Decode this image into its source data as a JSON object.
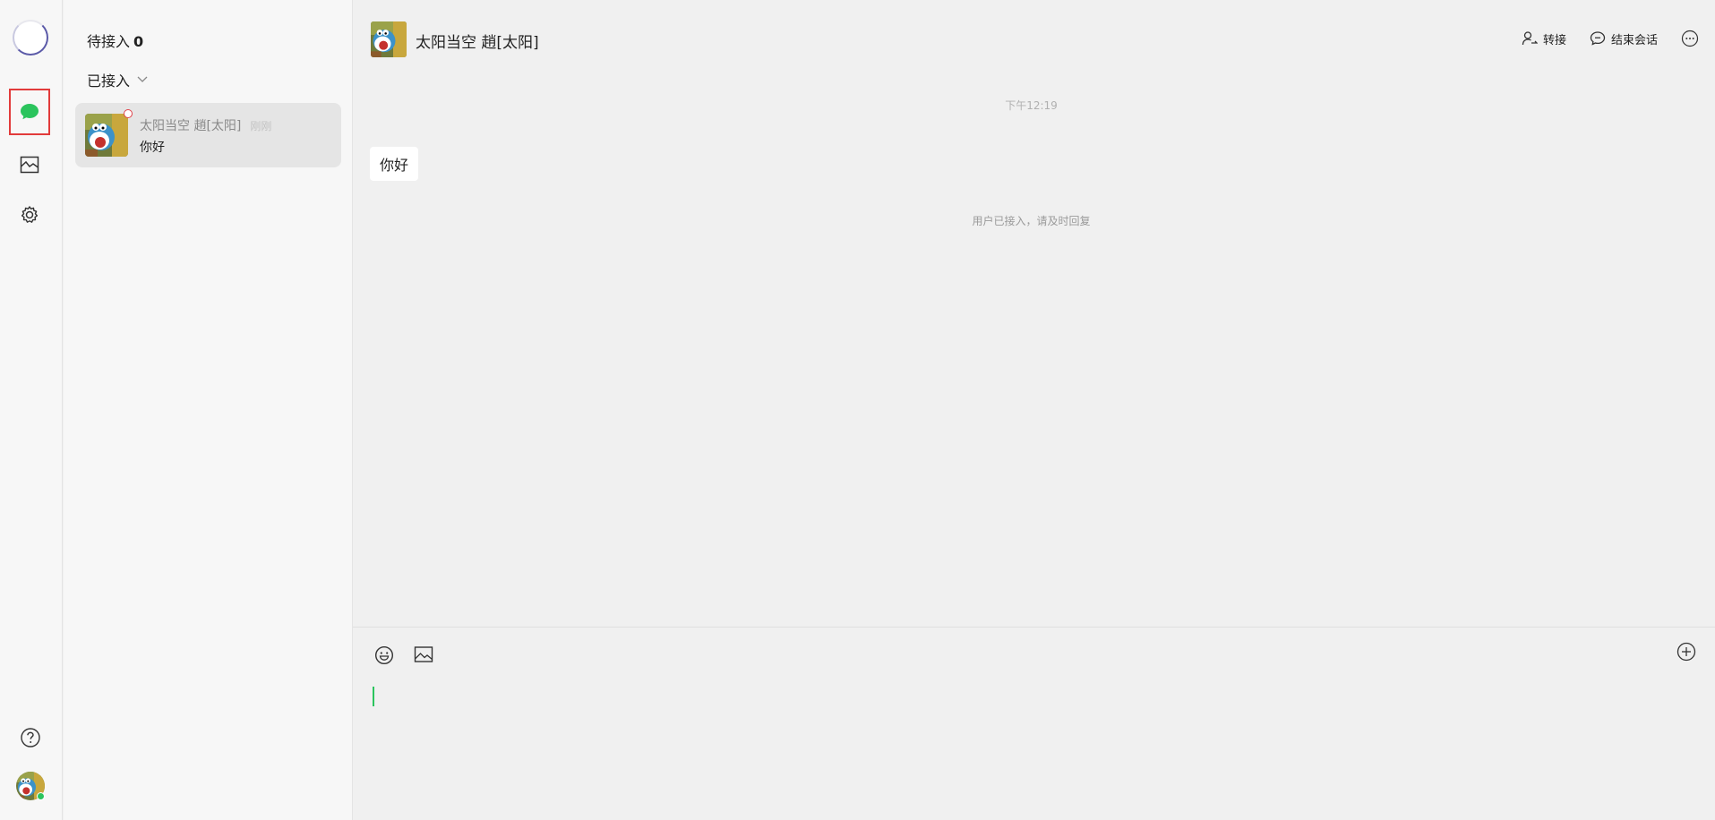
{
  "rail": {
    "items": [
      {
        "name": "chat",
        "icon": "chat-bubble-icon",
        "active": true
      },
      {
        "name": "stats",
        "icon": "chart-icon",
        "active": false
      },
      {
        "name": "settings",
        "icon": "gear-icon",
        "active": false
      }
    ],
    "help_icon": "help-icon",
    "status": "online"
  },
  "sessions": {
    "waiting_label": "待接入",
    "waiting_count": "0",
    "joined_label": "已接入",
    "items": [
      {
        "name": "太阳当空 趙[太阳]",
        "time": "刚刚",
        "last_message": "你好",
        "unread": true
      }
    ]
  },
  "chat": {
    "title": "太阳当空 趙[太阳]",
    "actions": {
      "transfer": "转接",
      "end": "结束会话"
    },
    "timestamp": "下午12:19",
    "messages": [
      {
        "from": "customer",
        "text": "你好"
      }
    ],
    "system_note": "用户已接入，请及时回复"
  },
  "colors": {
    "accent": "#2bc45d",
    "highlight_border": "#e23b3b"
  }
}
